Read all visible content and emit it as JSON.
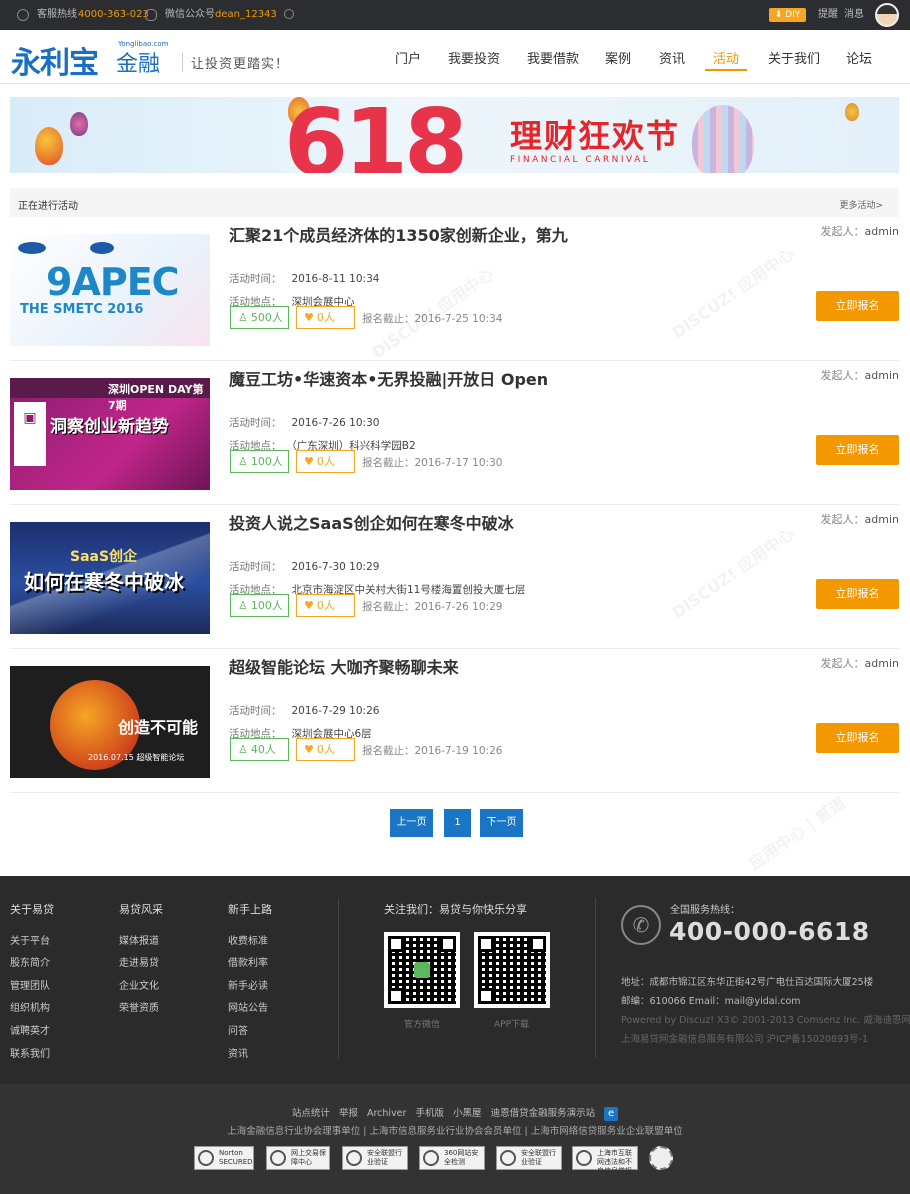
{
  "topbar": {
    "hotline_label": "客服热线",
    "hotline_number": "4000-363-023",
    "wechat_label": "微信公众号",
    "wechat_id": "dean_12343",
    "diy_label": "DIY",
    "remind_label": "提醒",
    "message_label": "消息"
  },
  "header": {
    "logo_text": "永利宝",
    "logo_suffix": "金融",
    "logo_url": "Yonglibao.com",
    "slogan": "让投资更踏实！",
    "nav": [
      "门户",
      "我要投资",
      "我要借款",
      "案例",
      "资讯",
      "活动",
      "关于我们",
      "论坛"
    ],
    "active_nav": "活动"
  },
  "banner": {
    "number": "618",
    "title": "理财狂欢节",
    "subtitle": "FINANCIAL CARNIVAL"
  },
  "section": {
    "title": "正在进行活动",
    "more": "更多活动>"
  },
  "labels": {
    "time": "活动时间：",
    "place": "活动地点：",
    "deadline": "报名截止：",
    "organizer": "发起人：",
    "signup": "立即报名"
  },
  "events": [
    {
      "title": "汇聚21个成员经济体的1350家创新企业，第九",
      "organizer": "admin",
      "time": "2016-8-11 10:34",
      "place": "深圳会展中心",
      "joined": "500人",
      "likes": "0人",
      "deadline": "2016-7-25 10:34",
      "thumb_text": "9APEC",
      "thumb_sub": "THE SMETC 2016"
    },
    {
      "title": "魔豆工坊•华速资本•无界投融|开放日 Open",
      "organizer": "admin",
      "time": "2016-7-26 10:30",
      "place": "（广东深圳）科兴科学园B2",
      "joined": "100人",
      "likes": "0人",
      "deadline": "2016-7-17 10:30",
      "thumb_text": "洞察创业新趋势",
      "thumb_sub": "深圳OPEN DAY第7期"
    },
    {
      "title": "投资人说之SaaS创企如何在寒冬中破冰",
      "organizer": "admin",
      "time": "2016-7-30 10:29",
      "place": "北京市海淀区中关村大街11号楼海置创投大厦七层",
      "joined": "100人",
      "likes": "0人",
      "deadline": "2016-7-26 10:29",
      "thumb_text": "如何在寒冬中破冰",
      "thumb_sub": "SaaS创企"
    },
    {
      "title": "超级智能论坛 大咖齐聚畅聊未来",
      "organizer": "admin",
      "time": "2016-7-29 10:26",
      "place": "深圳会展中心6层",
      "joined": "40人",
      "likes": "0人",
      "deadline": "2016-7-19 10:26",
      "thumb_text": "创造不可能",
      "thumb_sub": "2016.07.15 超级智能论坛"
    }
  ],
  "pager": {
    "prev": "上一页",
    "page": "1",
    "next": "下一页"
  },
  "footer": {
    "col1": {
      "title": "关于易贷",
      "items": [
        "关于平台",
        "股东简介",
        "管理团队",
        "组织机构",
        "诚聘英才",
        "联系我们"
      ]
    },
    "col2": {
      "title": "易贷风采",
      "items": [
        "媒体报道",
        "走进易贷",
        "企业文化",
        "荣誉资质"
      ]
    },
    "col3": {
      "title": "新手上路",
      "items": [
        "收费标准",
        "借款利率",
        "新手必读",
        "网站公告",
        "问答",
        "资讯"
      ]
    },
    "follow_title": "关注我们：易贷与你快乐分享",
    "qr1_caption": "官方微信",
    "qr2_caption": "APP下载",
    "hotline_label": "全国服务热线：",
    "hotline": "400-000-6618",
    "address": "地址：成都市锦江区东华正街42号广电仕百达国际大厦25楼",
    "email": "邮编：610066 Email：mail@yidai.com",
    "powered": "Powered by Discuz! X3© 2001-2013 Comsenz Inc.  威海迪恩网络",
    "company": "上海易贷网金融信息服务有限公司  沪ICP备15020893号-1"
  },
  "bottom": {
    "links": [
      "站点统计",
      "举报",
      "Archiver",
      "手机版",
      "小黑屋",
      "迪恩借贷金融服务演示站"
    ],
    "cert_line": "上海金融信息行业协会理事单位 | 上海市信息服务业行业协会会员单位 | 上海市网络信贷服务业企业联盟单位",
    "badges": [
      "Norton SECURED",
      "网上交易保障中心",
      "安全联盟行业验证",
      "360网站安全检测",
      "安全联盟行业验证",
      "上海市互联网违法和不良信息举报中心"
    ]
  }
}
